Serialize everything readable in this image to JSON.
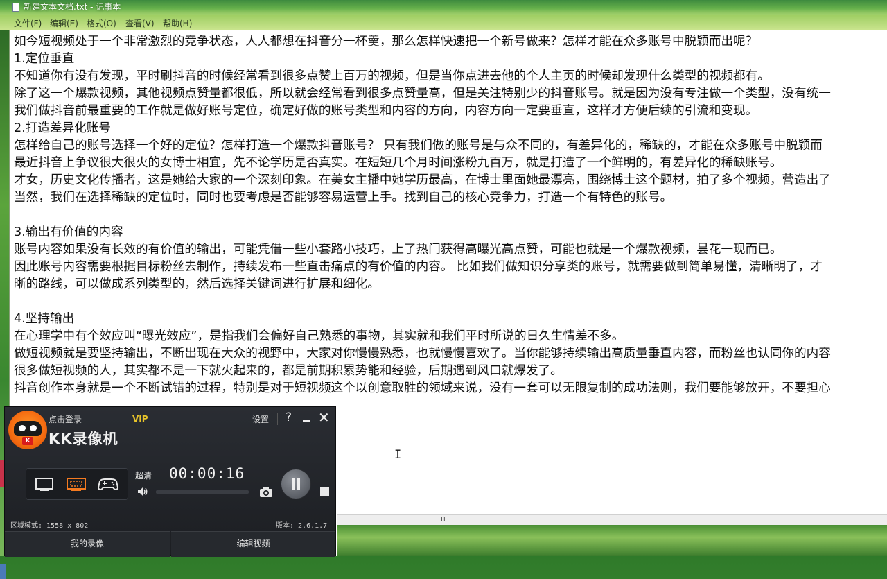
{
  "notepad": {
    "title": "新建文本文档.txt - 记事本",
    "menu": [
      {
        "label": "文件(F)"
      },
      {
        "label": "编辑(E)"
      },
      {
        "label": "格式(O)"
      },
      {
        "label": "查看(V)"
      },
      {
        "label": "帮助(H)"
      }
    ],
    "lines": [
      "如今短视频处于一个非常激烈的竞争状态，人人都想在抖音分一杯羹，那么怎样快速把一个新号做来？怎样才能在众多账号中脱颖而出呢？",
      "1.定位垂直",
      "不知道你有没有发现，平时刷抖音的时候经常看到很多点赞上百万的视频，但是当你点进去他的个人主页的时候却发现什么类型的视频都有。",
      "除了这一个爆款视频，其他视频点赞量都很低，所以就会经常看到很多点赞量高，但是关注特别少的抖音账号。就是因为没有专注做一个类型，没有统一",
      "我们做抖音前最重要的工作就是做好账号定位，确定好做的账号类型和内容的方向，内容方向一定要垂直，这样才方便后续的引流和变现。",
      "2.打造差异化账号",
      "怎样给自己的账号选择一个好的定位？怎样打造一个爆款抖音账号？ 只有我们做的账号是与众不同的，有差异化的，稀缺的，才能在众多账号中脱颖而",
      "最近抖音上争议很大很火的女博士相宜，先不论学历是否真实。在短短几个月时间涨粉九百万，就是打造了一个鲜明的，有差异化的稀缺账号。",
      "才女，历史文化传播者，这是她给大家的一个深刻印象。在美女主播中她学历最高，在博士里面她最漂亮，围绕博士这个题材，拍了多个视频，营造出了",
      "当然，我们在选择稀缺的定位时，同时也要考虑是否能够容易运营上手。找到自己的核心竞争力，打造一个有特色的账号。",
      "",
      "3.输出有价值的内容",
      "账号内容如果没有长效的有价值的输出，可能凭借一些小套路小技巧，上了热门获得高曝光高点赞，可能也就是一个爆款视频，昙花一现而已。",
      "因此账号内容需要根据目标粉丝去制作，持续发布一些直击痛点的有价值的内容。 比如我们做知识分享类的账号，就需要做到简单易懂，清晰明了，才",
      "晰的路线，可以做成系列类型的，然后选择关键词进行扩展和细化。",
      "",
      "4.坚持输出",
      "在心理学中有个效应叫“曝光效应”，是指我们会偏好自己熟悉的事物，其实就和我们平时所说的日久生情差不多。",
      "做短视频就是要坚持输出，不断出现在大众的视野中，大家对你慢慢熟悉，也就慢慢喜欢了。当你能够持续输出高质量垂直内容，而粉丝也认同你的内容",
      "很多做短视频的人，其实都不是一下就火起来的，都是前期积累势能和经验，后期遇到风口就爆发了。",
      "抖音创作本身就是一个不断试错的过程，特别是对于短视频这个以创意取胜的领域来说，没有一套可以无限复制的成功法则，我们要能够放开，不要担心"
    ],
    "scroll_thumb": "III"
  },
  "recorder": {
    "login": "点击登录",
    "vip": "VIP",
    "name": "KK录像机",
    "settings": "设置",
    "help": "?",
    "logo_badge": "K",
    "quality": "超清",
    "timer": "00:00:16",
    "area_mode": "区域模式: 1558 x 802",
    "version": "版本: 2.6.1.7",
    "my_recordings": "我的录像",
    "edit_video": "编辑视频",
    "accent_color": "#f47a20"
  }
}
